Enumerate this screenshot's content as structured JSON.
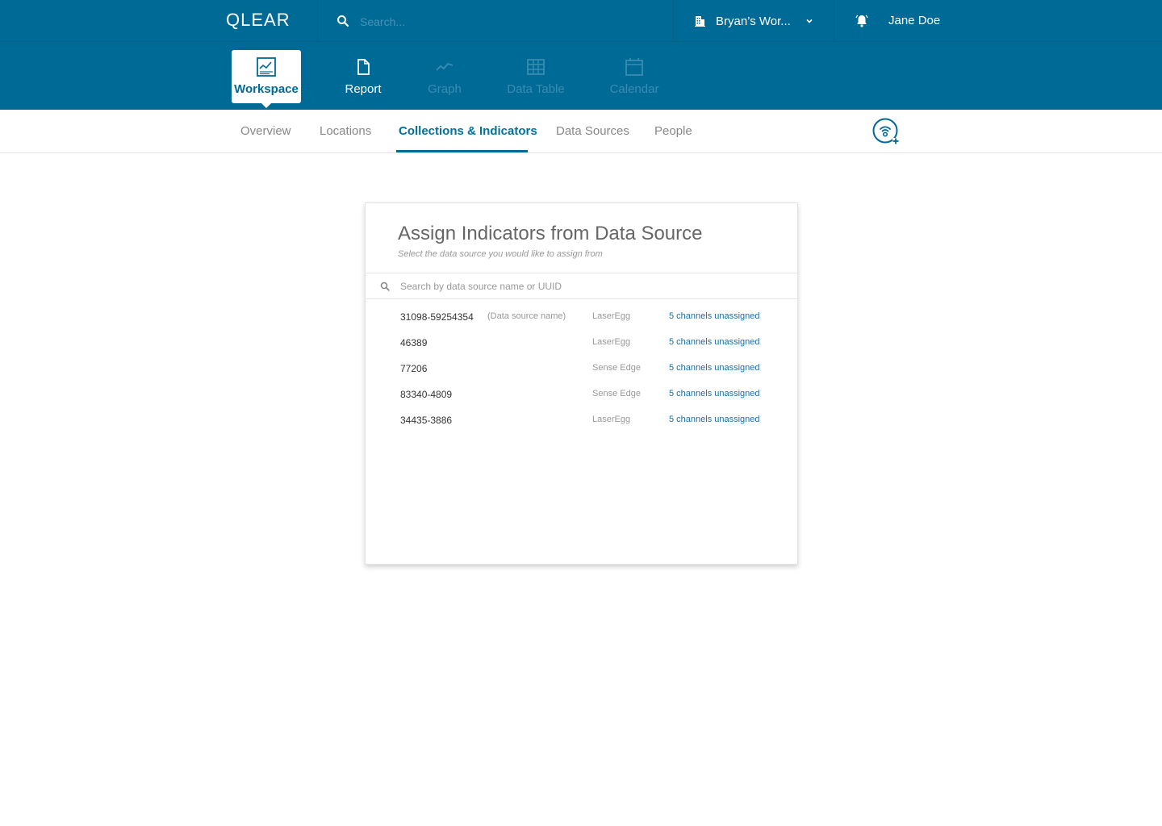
{
  "colors": {
    "primary": "#006a96",
    "link": "#1a6fa8",
    "muted_tab": "#3a8cb2"
  },
  "topbar": {
    "logo": "QLEAR",
    "search_placeholder": "Search...",
    "search_icon": "search-icon",
    "workspace_label": "Bryan’s Wor...",
    "workspace_icon": "building-icon",
    "bell_icon": "bell-icon",
    "user_name": "Jane Doe"
  },
  "app_tabs": [
    {
      "label": "Workspace",
      "icon": "workspace-chart-icon",
      "state": "active"
    },
    {
      "label": "Report",
      "icon": "document-icon",
      "state": "enabled"
    },
    {
      "label": "Graph",
      "icon": "line-graph-icon",
      "state": "disabled"
    },
    {
      "label": "Data Table",
      "icon": "table-icon",
      "state": "disabled"
    },
    {
      "label": "Calendar",
      "icon": "calendar-icon",
      "state": "disabled"
    }
  ],
  "sub_tabs": [
    {
      "label": "Overview",
      "active": false
    },
    {
      "label": "Locations",
      "active": false
    },
    {
      "label": "Collections & Indicators",
      "active": true
    },
    {
      "label": "Data Sources",
      "active": false
    },
    {
      "label": "People",
      "active": false
    }
  ],
  "add_sensor_icon": "add-sensor-icon",
  "card": {
    "title": "Assign Indicators from Data Source",
    "subtitle": "Select the data source you would like to assign from",
    "search_placeholder": "Search by data source name or UUID",
    "rows": [
      {
        "uuid": "31098-59254354",
        "name": "(Data source name)",
        "type": "LaserEgg",
        "channels": "5 channels unassigned"
      },
      {
        "uuid": "46389",
        "name": "",
        "type": "LaserEgg",
        "channels": "5 channels unassigned"
      },
      {
        "uuid": "77206",
        "name": "",
        "type": "Sense Edge",
        "channels": "5 channels unassigned"
      },
      {
        "uuid": "83340-4809",
        "name": "",
        "type": "Sense Edge",
        "channels": "5 channels unassigned"
      },
      {
        "uuid": "34435-3886",
        "name": "",
        "type": "LaserEgg",
        "channels": "5 channels unassigned"
      }
    ]
  }
}
